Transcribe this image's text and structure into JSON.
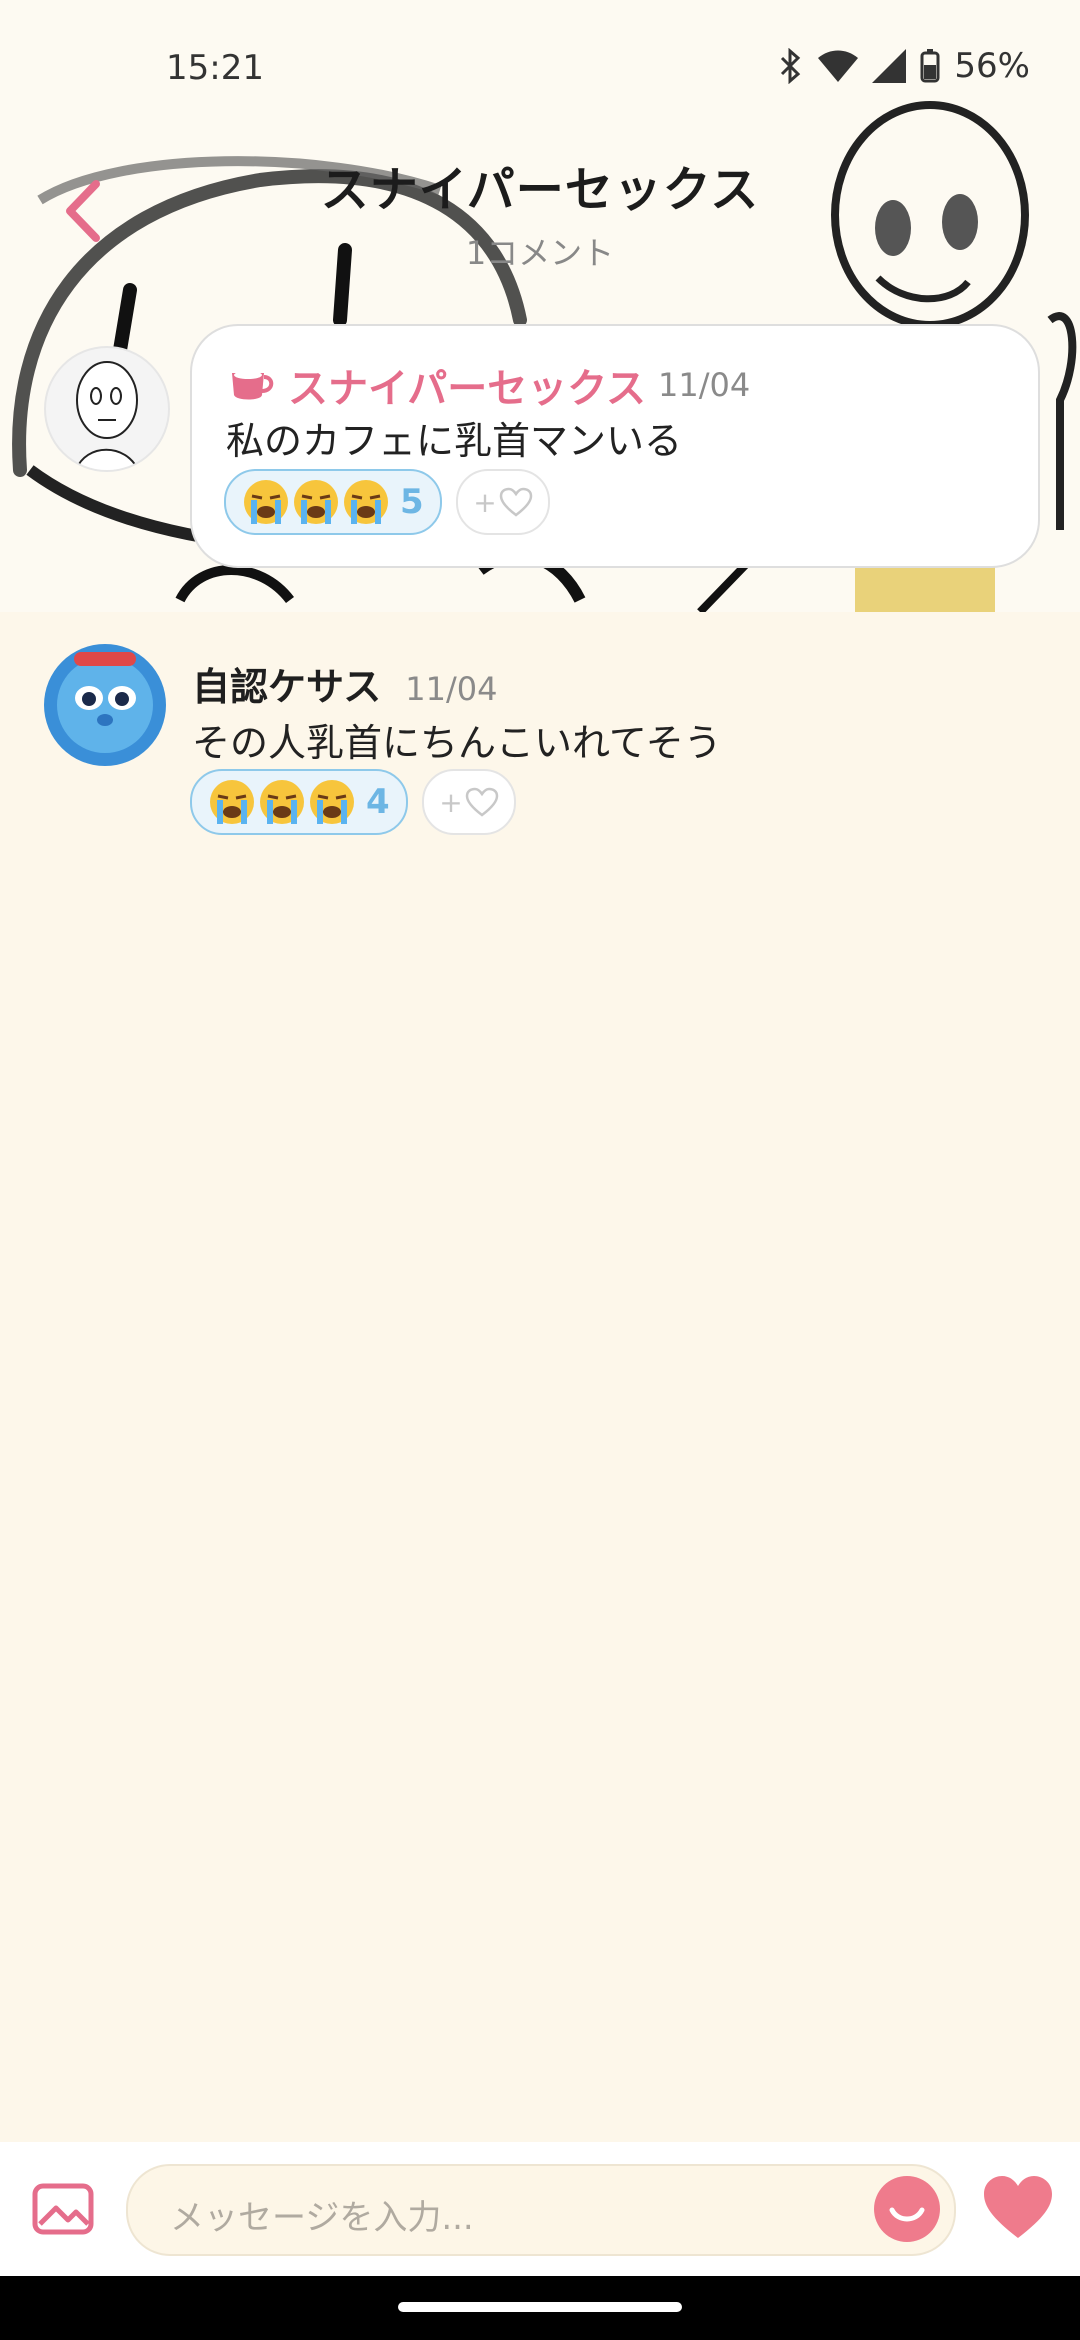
{
  "status_bar": {
    "time": "15:21",
    "battery": "56%"
  },
  "header": {
    "title": "スナイパーセックス",
    "comment_count": "1コメント"
  },
  "post": {
    "author": "スナイパーセックス",
    "date": "11/04",
    "text": "私のカフェに乳首マンいる",
    "reaction": {
      "emoji": "loudly-crying-face",
      "count": "5"
    },
    "add_reaction": "+"
  },
  "comments": [
    {
      "author": "自認ケサス",
      "date": "11/04",
      "text": "その人乳首にちんこいれてそう",
      "reaction": {
        "emoji": "loudly-crying-face",
        "count": "4"
      },
      "add_reaction": "+"
    }
  ],
  "input_bar": {
    "placeholder": "メッセージを入力..."
  },
  "colors": {
    "accent": "#e56d8b",
    "reaction_blue": "#6db6e4",
    "background": "#fdf7ea"
  }
}
